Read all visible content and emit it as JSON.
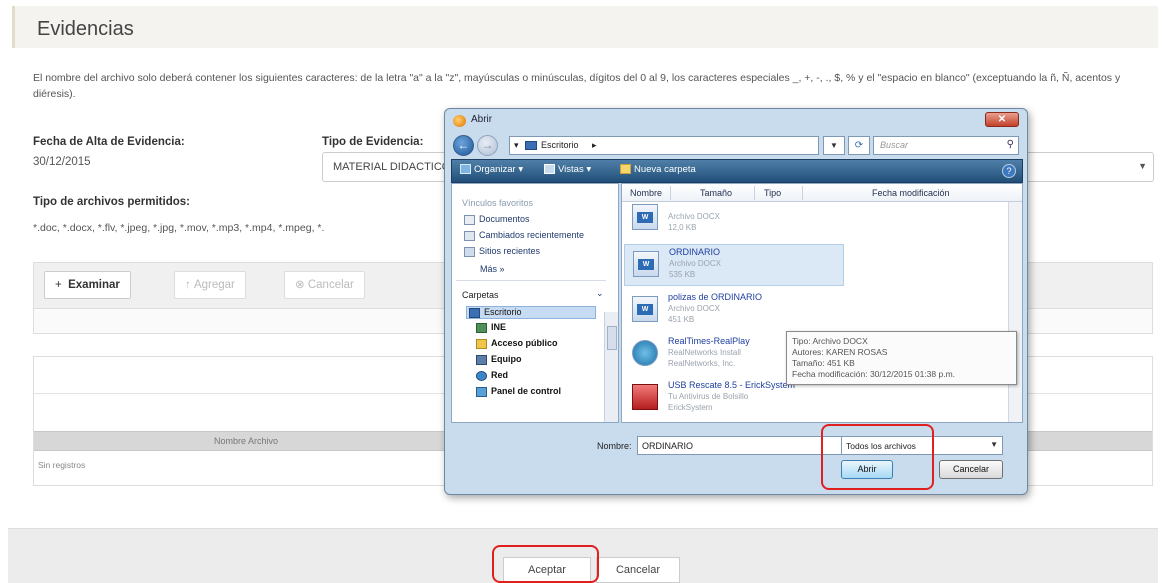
{
  "page": {
    "title": "Evidencias",
    "instructions": "El nombre del archivo solo deberá contener los siguientes caracteres: de la letra \"a\" a la \"z\", mayúsculas o minúsculas, dígitos del 0 al 9, los caracteres especiales _, +, -, ., $, % y el \"espacio en blanco\" (exceptuando la ñ, Ñ, acentos y diéresis).",
    "fecha_label": "Fecha de Alta de Evidencia:",
    "fecha_value": "30/12/2015",
    "tipo_label": "Tipo de Evidencia:",
    "tipo_value": "MATERIAL DIDACTICO",
    "tipos_archivo_label": "Tipo de archivos permitidos:",
    "tipos_archivo_value": "*.doc, *.docx, *.flv, *.jpeg, *.jpg, *.mov, *.mp3, *.mp4, *.mpeg, *.",
    "upload_buttons": {
      "examinar": "Examinar",
      "agregar": "Agregar",
      "cancelar": "Cancelar"
    },
    "files_table": {
      "col_nombre": "Nombre Archivo",
      "empty": "Sin registros"
    },
    "footer": {
      "aceptar": "Aceptar",
      "cancelar": "Cancelar"
    }
  },
  "dialog": {
    "title": "Abrir",
    "address": "Escritorio",
    "search_placeholder": "Buscar",
    "toolbar": {
      "organizar": "Organizar",
      "vistas": "Vistas",
      "nueva_carpeta": "Nueva carpeta"
    },
    "nav": {
      "favoritos_label": "Vínculos favoritos",
      "favoritos": [
        "Documentos",
        "Cambiados recientemente",
        "Sitios recientes"
      ],
      "mas": "Más »",
      "carpetas_label": "Carpetas",
      "carpetas": [
        "Escritorio",
        "INE",
        "Acceso público",
        "Equipo",
        "Red",
        "Panel de control"
      ]
    },
    "columns": [
      "Nombre",
      "Tamaño",
      "Tipo",
      "Fecha modificación"
    ],
    "files": [
      {
        "name": "",
        "type": "Archivo DOCX",
        "size": "12,0 KB"
      },
      {
        "name": "ORDINARIO",
        "type": "Archivo DOCX",
        "size": "535 KB"
      },
      {
        "name": "polizas de ORDINARIO",
        "type": "Archivo DOCX",
        "size": "451 KB"
      },
      {
        "name": "RealTimes-RealPlay",
        "type": "RealNetworks Install",
        "size": "RealNetworks, Inc."
      },
      {
        "name": "USB Rescate 8.5 - ErickSystem",
        "type": "Tu Antivirus de Bolsillo",
        "size": "ErickSystem"
      }
    ],
    "tooltip": {
      "tipo": "Tipo: Archivo DOCX",
      "autores": "Autores: KAREN ROSAS",
      "tamano": "Tamaño: 451 KB",
      "fecha": "Fecha modificación: 30/12/2015 01:38 p.m."
    },
    "name_label": "Nombre:",
    "name_value": "ORDINARIO",
    "filter": "Todos los archivos",
    "open": "Abrir",
    "cancel": "Cancelar"
  },
  "colors": {
    "highlight": "#e02020",
    "toolbar": "#214f79",
    "link": "#1e3fa0"
  }
}
